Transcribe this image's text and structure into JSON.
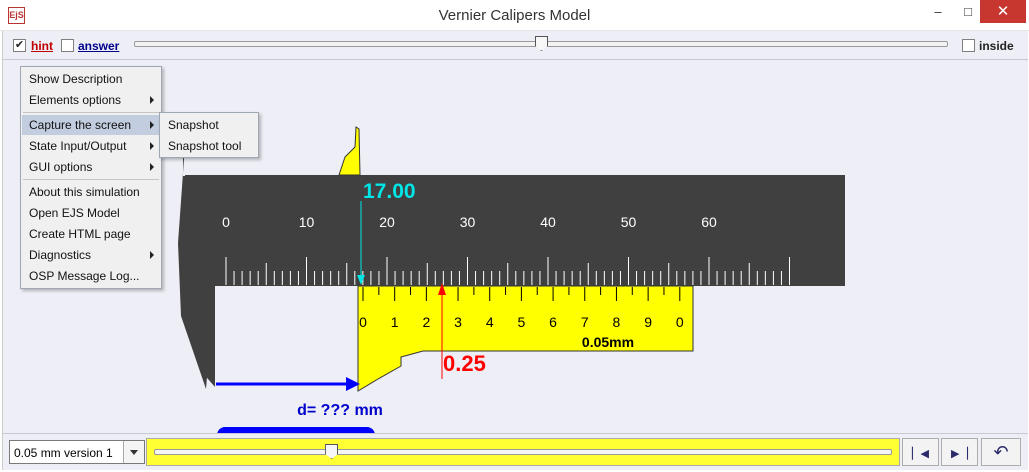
{
  "window": {
    "app_icon_text": "EjS",
    "title": "Vernier Calipers Model",
    "minimize_glyph": "–",
    "maximize_glyph": "□",
    "close_glyph": "✕"
  },
  "topbar": {
    "hint_label": "hint",
    "hint_checked": true,
    "answer_label": "answer",
    "answer_checked": false,
    "slider_value": 0.5,
    "inside_label": "inside",
    "inside_checked": false,
    "check_glyph": "✔"
  },
  "caliper": {
    "main_scale_labels": [
      "0",
      "10",
      "20",
      "30",
      "40",
      "50",
      "60"
    ],
    "vernier_labels": [
      "0",
      "1",
      "2",
      "3",
      "4",
      "5",
      "6",
      "7",
      "8",
      "9",
      "0"
    ],
    "least_count_label": "0.05mm",
    "main_reading": "17.00",
    "vernier_reading": "0.25",
    "distance_label": "d= ??? mm",
    "colors": {
      "main_scale": "#404040",
      "vernier": "#ffff00",
      "main_reading": "#00e5e5",
      "vernier_reading": "#ff0000",
      "measurement": "#0000ff"
    }
  },
  "menu": {
    "items": [
      {
        "label": "Show Description",
        "submenu": false
      },
      {
        "label": "Elements options",
        "submenu": true
      },
      {
        "label": "Capture the screen",
        "submenu": true,
        "active": true
      },
      {
        "label": "State Input/Output",
        "submenu": true
      },
      {
        "label": "GUI options",
        "submenu": true
      },
      {
        "label": "About this simulation",
        "submenu": false
      },
      {
        "label": "Open EJS Model",
        "submenu": false
      },
      {
        "label": "Create HTML page",
        "submenu": false
      },
      {
        "label": "Diagnostics",
        "submenu": true
      },
      {
        "label": "OSP Message Log...",
        "submenu": false
      }
    ],
    "submenu_items": [
      "Snapshot",
      "Snapshot tool"
    ]
  },
  "bottombar": {
    "version_select_value": "0.05 mm version 1",
    "slider_value": 0.24,
    "step_back_icon": "▏◀",
    "step_forward_icon": "▶▕",
    "reset_icon": "↶"
  }
}
